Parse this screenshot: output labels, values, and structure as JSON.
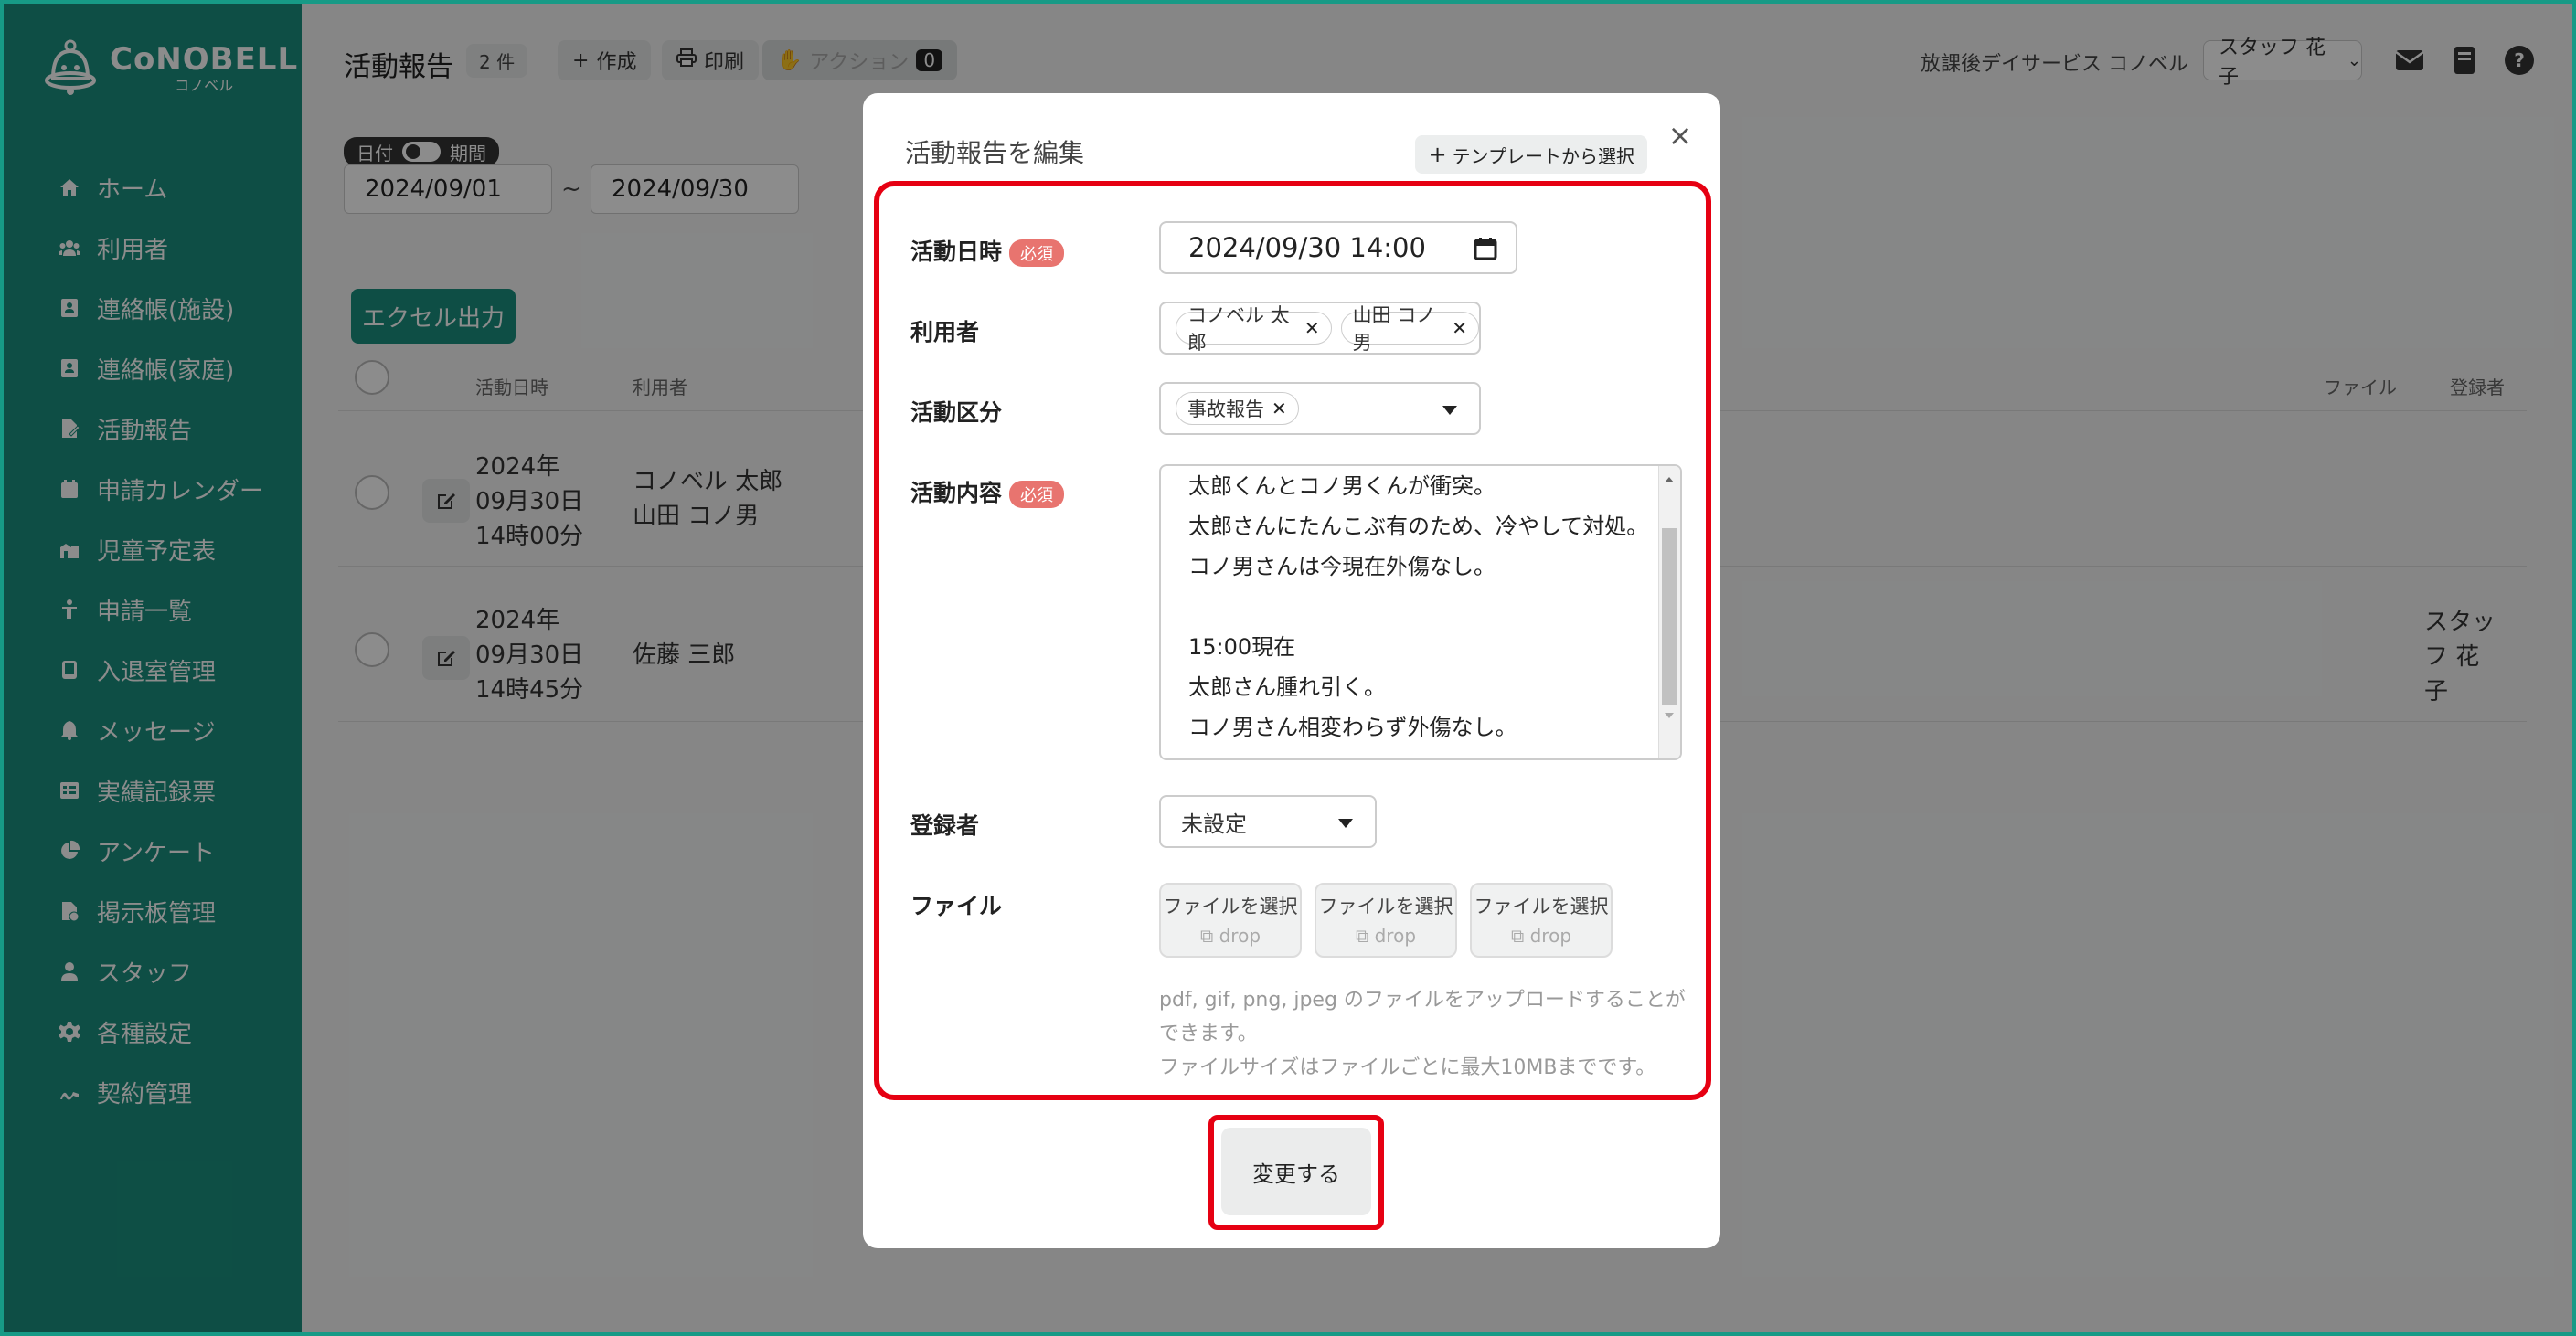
{
  "app": {
    "brand": "CoNOBELL",
    "brand_sub": "コノベル"
  },
  "sidebar": {
    "items": [
      {
        "label": "ホーム",
        "icon": "home-icon"
      },
      {
        "label": "利用者",
        "icon": "users-icon"
      },
      {
        "label": "連絡帳(施設)",
        "icon": "contact-book-icon"
      },
      {
        "label": "連絡帳(家庭)",
        "icon": "contact-book-icon"
      },
      {
        "label": "活動報告",
        "icon": "report-icon"
      },
      {
        "label": "申請カレンダー",
        "icon": "calendar-icon"
      },
      {
        "label": "児童予定表",
        "icon": "schedule-icon"
      },
      {
        "label": "申請一覧",
        "icon": "person-icon"
      },
      {
        "label": "入退室管理",
        "icon": "tablet-icon"
      },
      {
        "label": "メッセージ",
        "icon": "bell-icon"
      },
      {
        "label": "実績記録票",
        "icon": "table-icon"
      },
      {
        "label": "アンケート",
        "icon": "pie-icon"
      },
      {
        "label": "掲示板管理",
        "icon": "board-icon"
      },
      {
        "label": "スタッフ",
        "icon": "staff-icon"
      },
      {
        "label": "各種設定",
        "icon": "gear-icon"
      },
      {
        "label": "契約管理",
        "icon": "contract-icon"
      }
    ]
  },
  "header": {
    "title": "活動報告",
    "count": "2 件",
    "create_label": "作成",
    "print_label": "印刷",
    "action_label": "アクション",
    "action_count": "0",
    "facility": "放課後デイサービス コノベル",
    "staff": "スタッフ 花子"
  },
  "filters": {
    "toggle_left": "日付",
    "toggle_right": "期間",
    "date_from": "2024/09/01",
    "separator": "~",
    "date_to": "2024/09/30"
  },
  "main": {
    "excel_label": "エクセル出力",
    "columns": {
      "date": "活動日時",
      "user": "利用者",
      "file": "ファイル",
      "registrant": "登録者"
    },
    "rows": [
      {
        "date": "2024年\n09月30日\n14時00分",
        "users": "コノベル 太郎\n山田 コノ男",
        "registrant": ""
      },
      {
        "date": "2024年\n09月30日\n14時45分",
        "users": "佐藤 三郎",
        "registrant": "スタッ\nフ 花\n子"
      }
    ]
  },
  "modal": {
    "title": "活動報告を編集",
    "template_label": "テンプレートから選択",
    "close_label": "×",
    "required_label": "必須",
    "fields": {
      "datetime_label": "活動日時",
      "datetime_value": "2024/09/30 14:00",
      "users_label": "利用者",
      "users": [
        "コノベル 太郎",
        "山田 コノ男"
      ],
      "category_label": "活動区分",
      "category": "事故報告",
      "content_label": "活動内容",
      "content": "太郎くんとコノ男くんが衝突。\n太郎さんにたんこぶ有のため、冷やして対処。\nコノ男さんは今現在外傷なし。\n\n15:00現在\n太郎さん腫れ引く。\nコノ男さん相変わらず外傷なし。",
      "registrant_label": "登録者",
      "registrant": "未設定",
      "file_label": "ファイル",
      "file_buttons": [
        {
          "top": "ファイルを選択",
          "bottom": "drop"
        },
        {
          "top": "ファイルを選択",
          "bottom": "drop"
        },
        {
          "top": "ファイルを選択",
          "bottom": "drop"
        }
      ],
      "file_note": "pdf, gif, png, jpeg のファイルをアップロードすることができます。\nファイルサイズはファイルごとに最大10MBまでです。"
    },
    "submit_label": "変更する"
  },
  "colors": {
    "brand": "#1a8f7e",
    "highlight": "#e60012",
    "required": "#e8746f"
  }
}
